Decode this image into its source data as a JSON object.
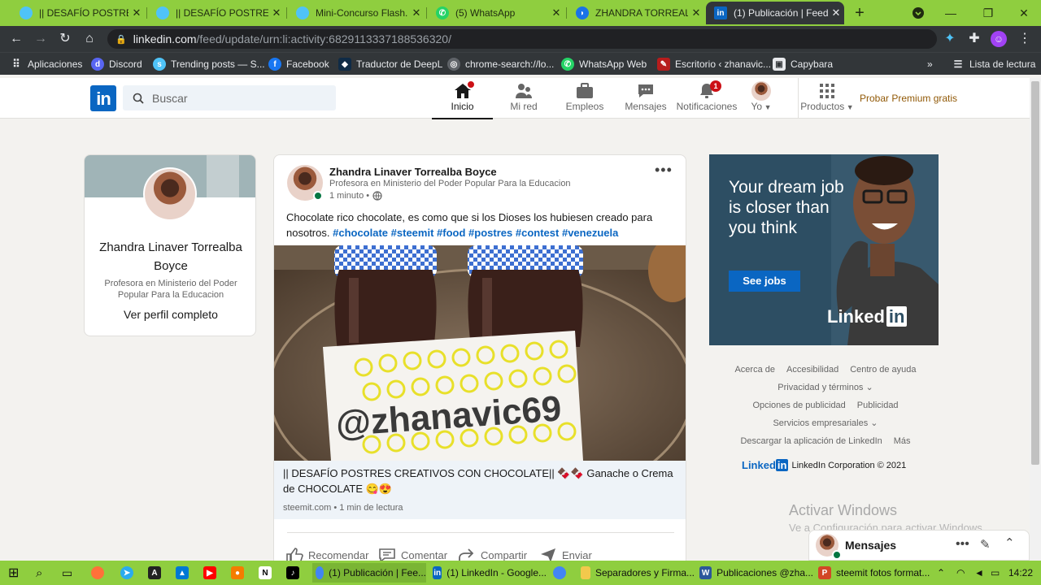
{
  "browser": {
    "tabs": [
      {
        "title": "|| DESAFÍO POSTRES C",
        "color": "#4fc3f7"
      },
      {
        "title": "|| DESAFÍO POSTRES C",
        "color": "#4fc3f7"
      },
      {
        "title": "Mini-Concurso Flash. /",
        "color": "#4fc3f7"
      },
      {
        "title": "(5) WhatsApp",
        "color": "#25d366"
      },
      {
        "title": "ZHANDRA TORREALBA",
        "color": "#1a73e8"
      },
      {
        "title": "(1) Publicación | Feed",
        "color": "#0a66c2"
      }
    ],
    "new_tab": "+",
    "url_host": "linkedin.com",
    "url_path": "/feed/update/urn:li:activity:6829113337188536320/",
    "bookmarks": [
      {
        "label": "Aplicaciones",
        "icon": "apps-grid-icon"
      },
      {
        "label": "Discord",
        "icon": "discord-icon"
      },
      {
        "label": "Trending posts — S...",
        "icon": "steemit-icon"
      },
      {
        "label": "Facebook",
        "icon": "facebook-icon"
      },
      {
        "label": "Traductor de DeepL",
        "icon": "deepl-icon"
      },
      {
        "label": "chrome-search://lo...",
        "icon": "chrome-icon"
      },
      {
        "label": "WhatsApp Web",
        "icon": "whatsapp-icon"
      },
      {
        "label": "Escritorio ‹ zhanavic...",
        "icon": "wordpress-icon"
      },
      {
        "label": "Capybara",
        "icon": "capybara-icon"
      }
    ],
    "overflow": "»",
    "reading_list": "Lista de lectura"
  },
  "linkedin": {
    "logo": "in",
    "search_placeholder": "Buscar",
    "nav": [
      {
        "label": "Inicio",
        "badge": ""
      },
      {
        "label": "Mi red",
        "badge": ""
      },
      {
        "label": "Empleos",
        "badge": ""
      },
      {
        "label": "Mensajes",
        "badge": ""
      },
      {
        "label": "Notificaciones",
        "badge": "1"
      },
      {
        "label": "Yo",
        "badge": ""
      },
      {
        "label": "Productos",
        "badge": ""
      }
    ],
    "premium": "Probar Premium gratis"
  },
  "profile": {
    "name": "Zhandra Linaver Torrealba Boyce",
    "title": "Profesora en Ministerio del Poder Popular Para la Educacion",
    "link": "Ver perfil completo"
  },
  "post": {
    "author": "Zhandra Linaver Torrealba Boyce",
    "author_title": "Profesora en Ministerio del Poder Popular Para la Educacion",
    "time": "1 minuto •",
    "text": "Chocolate rico chocolate, es como que si los Dioses los hubiesen creado para nosotros.",
    "hashtags": [
      "#chocolate",
      "#steemit",
      "#food",
      "#postres",
      "#contest",
      "#venezuela"
    ],
    "image_text": "@zhanavic69",
    "link_title": "|| DESAFÍO POSTRES CREATIVOS CON CHOCOLATE|| 🍫🍫 Ganache o Crema de CHOCOLATE 😋😍",
    "link_source": "steemit.com • 1 min de lectura",
    "actions": [
      "Recomendar",
      "Comentar",
      "Compartir",
      "Enviar"
    ]
  },
  "ad": {
    "headline": "Your dream job is closer than you think",
    "button": "See jobs",
    "brand": "Linked",
    "brand_in": "in"
  },
  "footer": {
    "row1": [
      "Acerca de",
      "Accesibilidad",
      "Centro de ayuda"
    ],
    "row2": "Privacidad y términos",
    "row3": [
      "Opciones de publicidad",
      "Publicidad"
    ],
    "row4": "Servicios empresariales",
    "row5": [
      "Descargar la aplicación de LinkedIn",
      "Más"
    ],
    "brand": "Linked",
    "brand_in": "in",
    "copyright": "LinkedIn Corporation © 2021"
  },
  "watermark": {
    "title": "Activar Windows",
    "subtitle": "Ve a Configuración para activar Windows."
  },
  "messaging": {
    "label": "Mensajes"
  },
  "taskbar": {
    "items": [
      {
        "label": "(1) Publicación | Fee...",
        "color": "#4285f4"
      },
      {
        "label": "(1) LinkedIn - Google...",
        "color": "#0a66c2"
      },
      {
        "label": "Separadores y Firma...",
        "color": "#f2c94c"
      },
      {
        "label": "Publicaciones @zha...",
        "color": "#2b579a"
      },
      {
        "label": "steemit fotos format...",
        "color": "#d24726"
      }
    ],
    "time": "14:22"
  }
}
